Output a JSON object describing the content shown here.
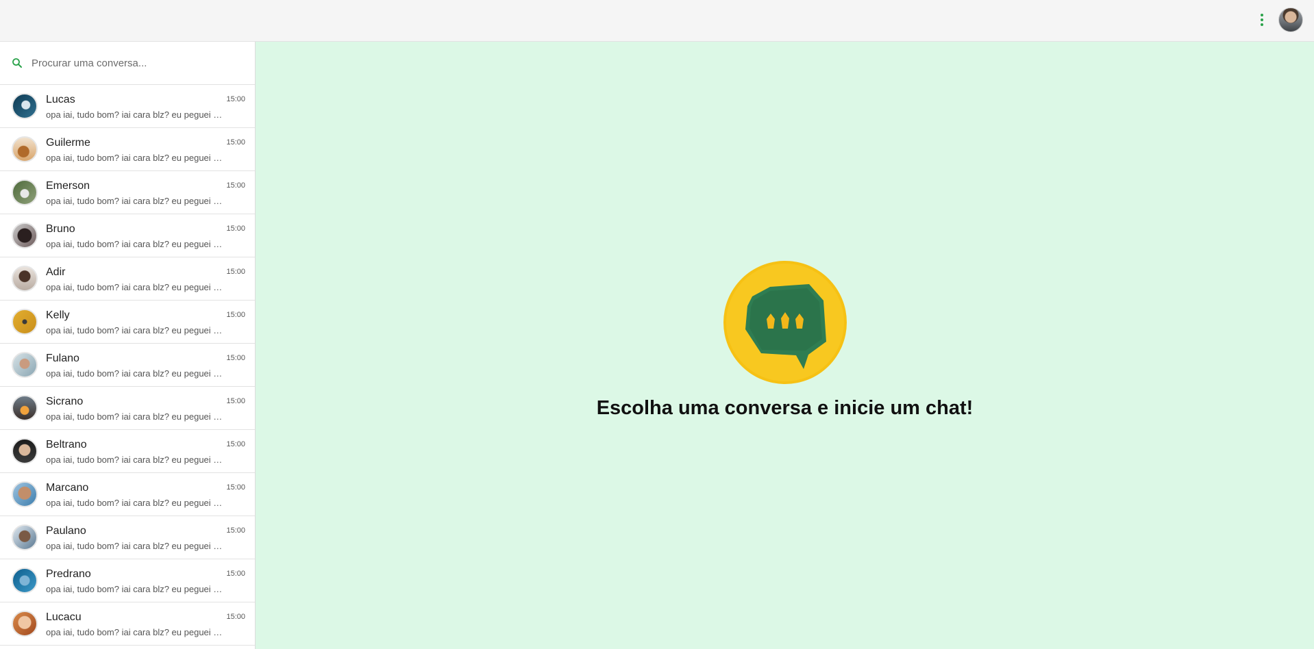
{
  "search": {
    "placeholder": "Procurar uma conversa..."
  },
  "chats": [
    {
      "name": "Lucas",
      "time": "15:00",
      "preview": "opa iai, tudo bom? iai cara blz? eu peguei co..."
    },
    {
      "name": "Guilerme",
      "time": "15:00",
      "preview": "opa iai, tudo bom? iai cara blz? eu peguei co..."
    },
    {
      "name": "Emerson",
      "time": "15:00",
      "preview": "opa iai, tudo bom? iai cara blz? eu peguei co..."
    },
    {
      "name": "Bruno",
      "time": "15:00",
      "preview": "opa iai, tudo bom? iai cara blz? eu peguei co..."
    },
    {
      "name": "Adir",
      "time": "15:00",
      "preview": "opa iai, tudo bom? iai cara blz? eu peguei co..."
    },
    {
      "name": "Kelly",
      "time": "15:00",
      "preview": "opa iai, tudo bom? iai cara blz? eu peguei co..."
    },
    {
      "name": "Fulano",
      "time": "15:00",
      "preview": "opa iai, tudo bom? iai cara blz? eu peguei co..."
    },
    {
      "name": "Sicrano",
      "time": "15:00",
      "preview": "opa iai, tudo bom? iai cara blz? eu peguei co..."
    },
    {
      "name": "Beltrano",
      "time": "15:00",
      "preview": "opa iai, tudo bom? iai cara blz? eu peguei co..."
    },
    {
      "name": "Marcano",
      "time": "15:00",
      "preview": "opa iai, tudo bom? iai cara blz? eu peguei co..."
    },
    {
      "name": "Paulano",
      "time": "15:00",
      "preview": "opa iai, tudo bom? iai cara blz? eu peguei co..."
    },
    {
      "name": "Predrano",
      "time": "15:00",
      "preview": "opa iai, tudo bom? iai cara blz? eu peguei co..."
    },
    {
      "name": "Lucacu",
      "time": "15:00",
      "preview": "opa iai, tudo bom? iai cara blz? eu peguei co..."
    }
  ],
  "main": {
    "title": "Escolha uma conversa e inicie um chat!"
  },
  "colors": {
    "accent": "#2aa24a",
    "main_bg": "#dcf8e6",
    "logo_yellow": "#f6c114",
    "logo_green": "#2e7d4f"
  }
}
